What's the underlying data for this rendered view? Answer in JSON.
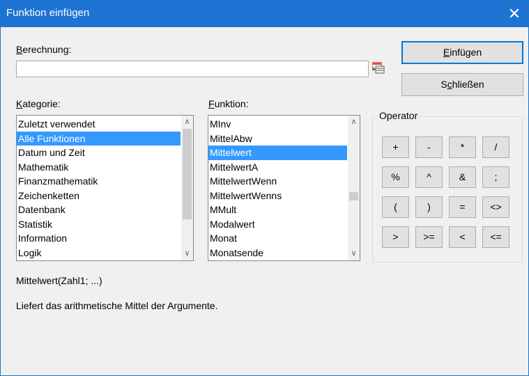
{
  "window": {
    "title": "Funktion einfügen"
  },
  "labels": {
    "berechnung": "Berechnung:",
    "kategorie": "Kategorie:",
    "funktion": "Funktion:",
    "operator": "Operator"
  },
  "buttons": {
    "insert": "Einfügen",
    "close": "Schließen"
  },
  "calculation": {
    "value": ""
  },
  "categories": {
    "items": [
      "Zuletzt verwendet",
      "Alle Funktionen",
      "Datum und Zeit",
      "Mathematik",
      "Finanzmathematik",
      "Zeichenketten",
      "Datenbank",
      "Statistik",
      "Information",
      "Logik"
    ],
    "selected": "Alle Funktionen"
  },
  "functions": {
    "items": [
      "MInv",
      "MittelAbw",
      "Mittelwert",
      "MittelwertA",
      "MittelwertWenn",
      "MittelwertWenns",
      "MMult",
      "Modalwert",
      "Monat",
      "Monatsende"
    ],
    "selected": "Mittelwert"
  },
  "operators": [
    "+",
    "-",
    "*",
    "/",
    "%",
    "^",
    "&",
    ";",
    "(",
    ")",
    "=",
    "<>",
    ">",
    ">=",
    "<",
    "<="
  ],
  "description": {
    "syntax": "Mittelwert(Zahl1; ...)",
    "text": "Liefert das arithmetische Mittel der Argumente."
  },
  "icons": {
    "close": "close-icon",
    "picker": "formula-picker-icon",
    "up": "scroll-up-arrow-icon",
    "down": "scroll-down-arrow-icon"
  }
}
